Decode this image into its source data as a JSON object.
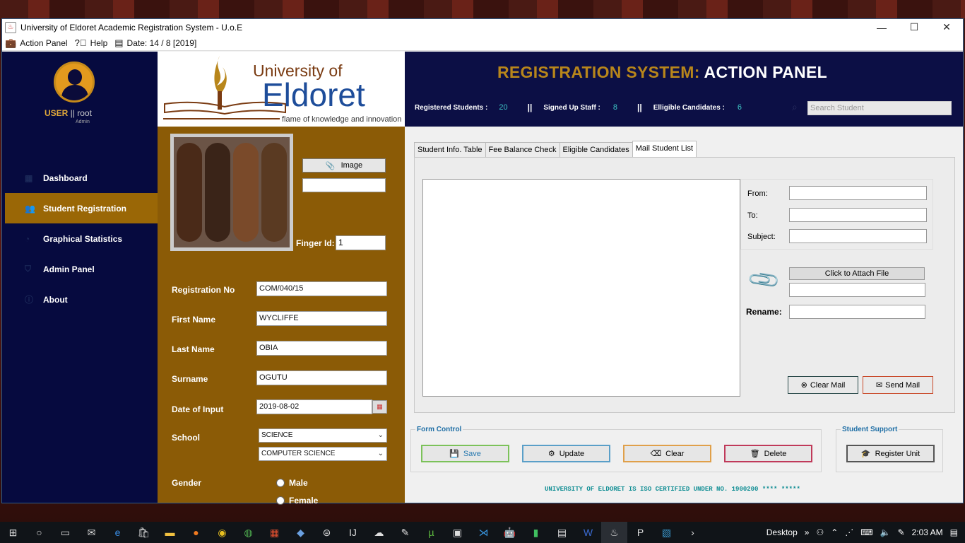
{
  "window": {
    "title": "University of Eldoret Academic Registration System - U.o.E",
    "controls": {
      "minimize": "—",
      "maximize": "☐",
      "close": "✕"
    }
  },
  "menubar": {
    "action_panel": "Action Panel",
    "help": "Help",
    "date": "Date: 14 / 8  [2019]"
  },
  "sidebar": {
    "user_label": "USER",
    "user_sep": " || ",
    "user_name": "root",
    "user_role": "Admin",
    "items": [
      {
        "label": "Dashboard",
        "icon": "grid-icon",
        "glyph": "▦",
        "active": false
      },
      {
        "label": "Student Registration",
        "icon": "users-icon",
        "glyph": "👥",
        "active": true
      },
      {
        "label": "Graphical Statistics",
        "icon": "chart-icon",
        "glyph": "◔",
        "active": false
      },
      {
        "label": "Admin Panel",
        "icon": "shield-icon",
        "glyph": "⛉",
        "active": false
      },
      {
        "label": "About",
        "icon": "info-icon",
        "glyph": "ⓘ",
        "active": false
      }
    ]
  },
  "logo": {
    "line1": "University of",
    "line2": "Eldoret",
    "tagline": "flame of knowledge and innovation"
  },
  "header": {
    "title_gold": "REGISTRATION SYSTEM:",
    "title_white": " ACTION PANEL",
    "stats": {
      "registered_label": "Registered Students :",
      "registered_value": "20",
      "sep": "||",
      "staff_label": "Signed Up Staff :",
      "staff_value": "8",
      "eligible_label": "Elligible Candidates :",
      "eligible_value": "6"
    },
    "search_placeholder": "Search Student"
  },
  "form": {
    "image_button": "Image",
    "finger_label": "Finger Id:",
    "finger_value": "1",
    "reg_label": "Registration No",
    "reg_value": "COM/040/15",
    "first_label": "First Name",
    "first_value": "WYCLIFFE",
    "last_label": "Last Name",
    "last_value": "OBIA",
    "surname_label": "Surname",
    "surname_value": "OGUTU",
    "date_label": "Date of Input",
    "date_value": "2019-08-02",
    "school_label": "School",
    "school_value": "SCIENCE",
    "dept_value": "COMPUTER SCIENCE",
    "gender_label": "Gender",
    "gender_male": "Male",
    "gender_female": "Female"
  },
  "tabs": [
    {
      "label": "Student Info. Table",
      "active": false
    },
    {
      "label": "Fee Balance Check",
      "active": false
    },
    {
      "label": "Eligible Candidates",
      "active": false
    },
    {
      "label": "Mail Student List",
      "active": true
    }
  ],
  "mail": {
    "from_label": "From:",
    "to_label": "To:",
    "subject_label": "Subject:",
    "attach_button": "Click to Attach File",
    "rename_label": "Rename:",
    "clear_button": "Clear Mail",
    "send_button": "Send Mail"
  },
  "form_control": {
    "title": "Form Control",
    "save": "Save",
    "update": "Update",
    "clear": "Clear",
    "delete": "Delete"
  },
  "student_support": {
    "title": "Student Support",
    "register_unit": "Register Unit"
  },
  "footer_note": "UNIVERSITY OF ELDORET IS ISO CERTIFIED UNDER NO. 1900200 **** *****",
  "taskbar": {
    "desktop_label": "Desktop",
    "time": "2:03 AM"
  },
  "colors": {
    "sidebar_bg": "#060a3f",
    "active_nav": "#9a6706",
    "form_bg": "#8b5b06",
    "header_gold": "#b8861b",
    "stat_value": "#3ec5c5",
    "footer_teal": "#138f95"
  }
}
